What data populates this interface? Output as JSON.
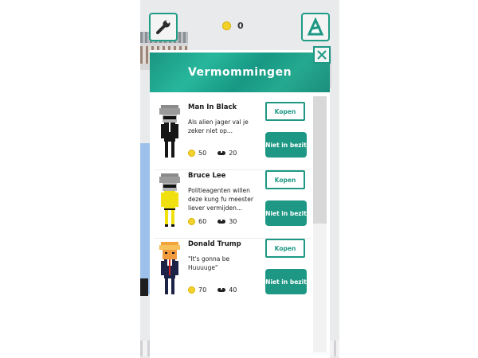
{
  "topbar": {
    "coins": "0",
    "settings_icon": "wrench-icon",
    "map_icon": "map-a-icon"
  },
  "modal": {
    "title": "Vermommingen",
    "close_icon": "close-icon",
    "items": [
      {
        "name": "Man In Black",
        "description": "Als alien jager val je zeker niet op...",
        "price": "50",
        "disguise": "20",
        "buy_label": "Kopen",
        "status_label": "Niet in bezit"
      },
      {
        "name": "Bruce Lee",
        "description": "Politieagenten willen deze kung fu meester liever vermijden...",
        "price": "60",
        "disguise": "30",
        "buy_label": "Kopen",
        "status_label": "Niet in bezit"
      },
      {
        "name": "Donald Trump",
        "description": "\"It's gonna be Huuuuge\"",
        "price": "70",
        "disguise": "40",
        "buy_label": "Kopen",
        "status_label": "Niet in bezit"
      }
    ]
  },
  "colors": {
    "accent": "#1e9884",
    "coin": "#f3d22b"
  }
}
